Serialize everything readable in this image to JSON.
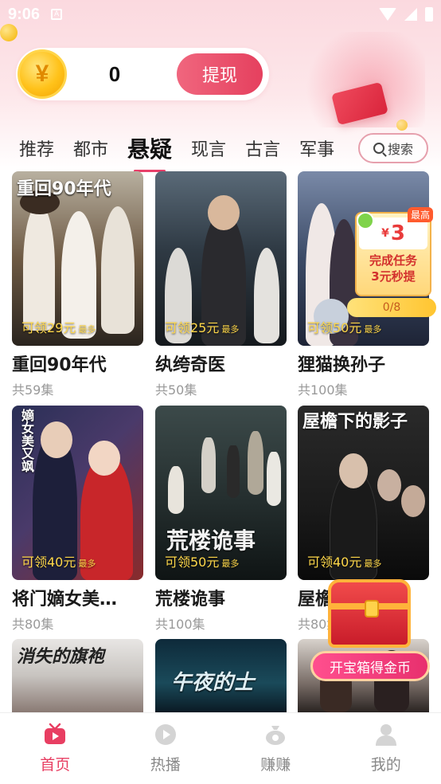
{
  "status": {
    "time": "9:06",
    "badge": "A"
  },
  "wallet": {
    "coin_symbol": "¥",
    "balance": "0",
    "withdraw_label": "提现"
  },
  "tabs": [
    {
      "label": "推荐"
    },
    {
      "label": "都市"
    },
    {
      "label": "悬疑",
      "active": true
    },
    {
      "label": "现言"
    },
    {
      "label": "古言"
    },
    {
      "label": "军事"
    }
  ],
  "search": {
    "label": "搜索"
  },
  "cards": [
    {
      "poster_text": "重回90年代",
      "reward": "可领29元",
      "reward_suffix": "最多",
      "title": "重回90年代",
      "episodes": "共59集"
    },
    {
      "poster_text": "",
      "reward": "可领25元",
      "reward_suffix": "最多",
      "title": "纨绔奇医",
      "episodes": "共50集"
    },
    {
      "poster_text": "",
      "reward": "可领50元",
      "reward_suffix": "最多",
      "title": "狸猫换孙子",
      "episodes": "共100集"
    },
    {
      "poster_text": "嫡女美又飒",
      "reward": "可领40元",
      "reward_suffix": "最多",
      "title": "将门嫡女美…",
      "episodes": "共80集"
    },
    {
      "poster_text": "荒楼诡事",
      "reward": "可领50元",
      "reward_suffix": "最多",
      "title": "荒楼诡事",
      "episodes": "共100集"
    },
    {
      "poster_text": "屋檐下的影子",
      "reward": "可领40元",
      "reward_suffix": "最多",
      "title": "屋檐下的影子",
      "episodes": "共80集"
    },
    {
      "poster_text": "消失的旗袍",
      "reward": "",
      "reward_suffix": "",
      "title": "",
      "episodes": ""
    },
    {
      "poster_text": "午夜的士",
      "reward": "",
      "reward_suffix": "",
      "title": "",
      "episodes": ""
    },
    {
      "poster_text": "",
      "reward": "",
      "reward_suffix": "",
      "title": "",
      "episodes": ""
    }
  ],
  "task": {
    "tag": "最高",
    "currency": "¥",
    "amount": "3",
    "line1": "完成任务",
    "line2": "3元秒提",
    "progress_text": "0/8",
    "progress": 0
  },
  "treasure": {
    "label": "开宝箱得金币"
  },
  "nav": [
    {
      "label": "首页",
      "icon": "tv-icon",
      "active": true
    },
    {
      "label": "热播",
      "icon": "play-icon"
    },
    {
      "label": "赚赚",
      "icon": "money-bag-icon"
    },
    {
      "label": "我的",
      "icon": "user-icon"
    }
  ],
  "colors": {
    "accent": "#e83e62",
    "reward": "#ffd84a",
    "header_pink": "#fbd9df"
  }
}
